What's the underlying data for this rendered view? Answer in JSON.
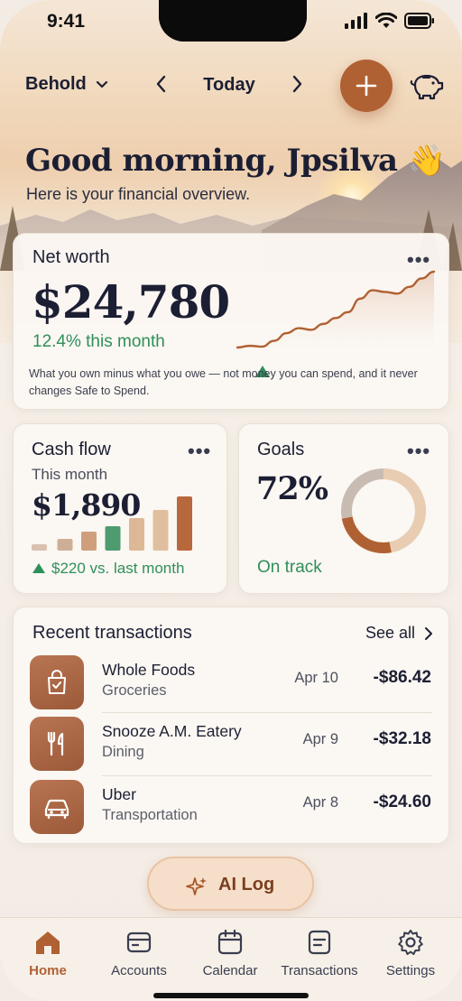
{
  "status_bar": {
    "time": "9:41"
  },
  "top_nav": {
    "brand": "Behold",
    "date_label": "Today",
    "prev_icon": "chevron-left-icon",
    "next_icon": "chevron-right-icon",
    "add_icon": "plus-icon",
    "savings_icon": "piggy-bank-icon"
  },
  "greeting": {
    "title": "Good morning, Jpsilva 👋",
    "subtitle": "Here is your financial overview."
  },
  "net_worth": {
    "title": "Net worth",
    "value": "$24,780",
    "change": "12.4% this month",
    "note": "What you own minus what you owe — not money you can spend, and it never changes Safe to Spend.",
    "trend": [
      10,
      12,
      11,
      18,
      27,
      33,
      31,
      38,
      45,
      52,
      68,
      78,
      76,
      74,
      82,
      92,
      100
    ]
  },
  "cash_flow": {
    "title": "Cash flow",
    "period": "This month",
    "value": "$1,890",
    "change": "$220 vs. last month",
    "bars": [
      7,
      13,
      21,
      27,
      36,
      45,
      60
    ],
    "highlight_index": 3
  },
  "goals": {
    "title": "Goals",
    "percent": "72%",
    "progress": 0.72,
    "status": "On track"
  },
  "transactions": {
    "title": "Recent transactions",
    "see_all": "See all",
    "items": [
      {
        "name": "Whole Foods",
        "category": "Groceries",
        "date": "Apr 10",
        "amount": "-$86.42",
        "icon": "shopping-bag-icon"
      },
      {
        "name": "Snooze A.M. Eatery",
        "category": "Dining",
        "date": "Apr 9",
        "amount": "-$32.18",
        "icon": "fork-knife-icon"
      },
      {
        "name": "Uber",
        "category": "Transportation",
        "date": "Apr 8",
        "amount": "-$24.60",
        "icon": "car-icon"
      }
    ]
  },
  "ai_log": {
    "label": "AI Log",
    "icon": "sparkle-icon"
  },
  "tab_bar": {
    "items": [
      {
        "label": "Home",
        "icon": "home-icon",
        "active": true
      },
      {
        "label": "Accounts",
        "icon": "wallet-icon",
        "active": false
      },
      {
        "label": "Calendar",
        "icon": "calendar-icon",
        "active": false
      },
      {
        "label": "Transactions",
        "icon": "document-icon",
        "active": false
      },
      {
        "label": "Settings",
        "icon": "gear-icon",
        "active": false
      }
    ]
  },
  "colors": {
    "accent": "#b06133",
    "positive": "#2f8f5b",
    "text": "#1c1f33"
  }
}
